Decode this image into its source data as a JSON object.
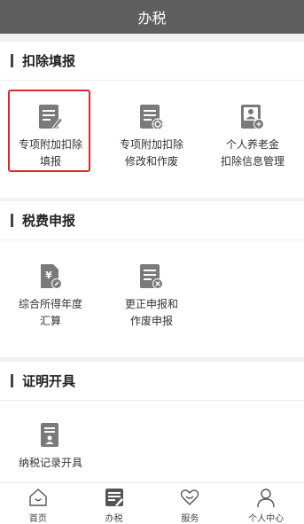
{
  "header": {
    "title": "办税"
  },
  "sections": [
    {
      "title": "扣除填报",
      "tiles": [
        {
          "icon": "document-edit-icon",
          "line1": "专项附加扣除",
          "line2": "填报"
        },
        {
          "icon": "document-settings-icon",
          "line1": "专项附加扣除",
          "line2": "修改和作废"
        },
        {
          "icon": "document-person-icon",
          "line1": "个人养老金",
          "line2": "扣除信息管理"
        }
      ]
    },
    {
      "title": "税费申报",
      "tiles": [
        {
          "icon": "tax-document-icon",
          "line1": "综合所得年度",
          "line2": "汇算"
        },
        {
          "icon": "document-cancel-icon",
          "line1": "更正申报和",
          "line2": "作废申报"
        }
      ]
    },
    {
      "title": "证明开具",
      "tiles": [
        {
          "icon": "certificate-icon",
          "line1": "纳税记录开具",
          "line2": ""
        }
      ]
    }
  ],
  "tabs": [
    {
      "icon": "home-icon",
      "label": "首页",
      "active": false
    },
    {
      "icon": "tax-office-icon",
      "label": "办税",
      "active": true
    },
    {
      "icon": "service-icon",
      "label": "服务",
      "active": false
    },
    {
      "icon": "user-icon",
      "label": "个人中心",
      "active": false
    }
  ],
  "colors": {
    "header_bg": "#5f5f5f",
    "icon_gray": "#7a7a7a",
    "highlight": "#e0262a"
  }
}
